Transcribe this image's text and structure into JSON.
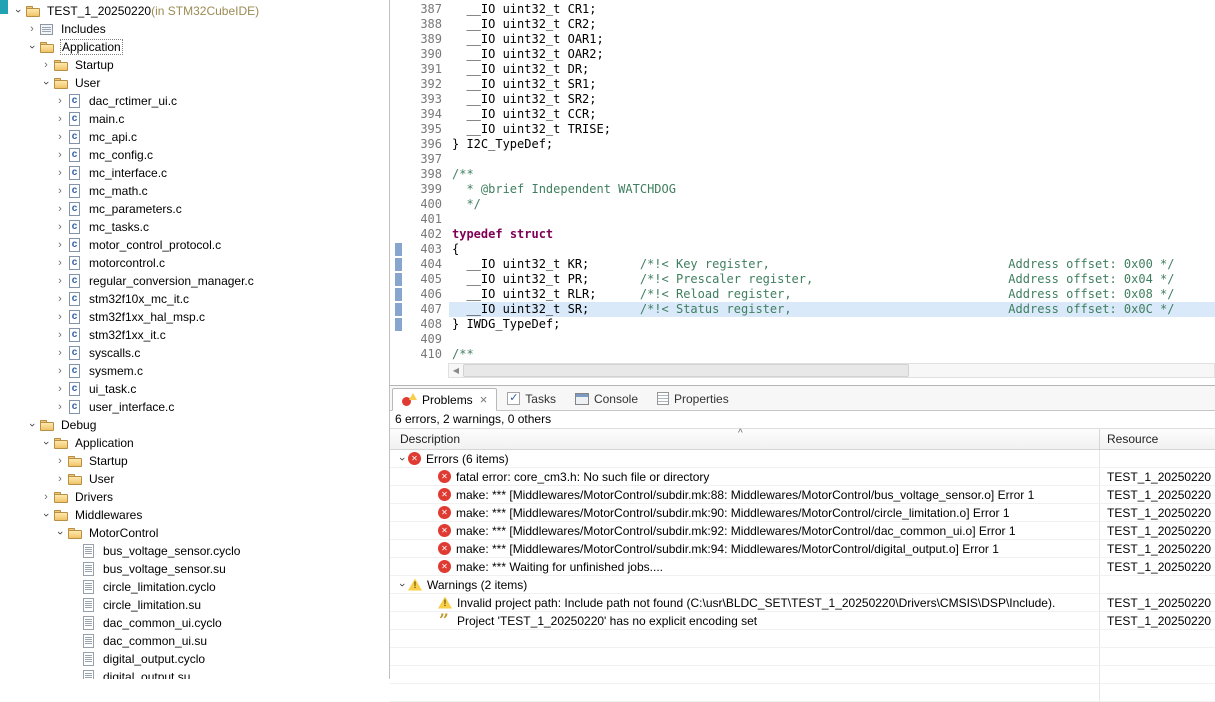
{
  "colors": {
    "keyword": "#7f0055",
    "comment": "#3f7f5f",
    "line_highlight": "#d9e9fa",
    "change_marker": "#87a5cd",
    "error_red": "#df3b32",
    "warning_yellow": "#f9ce4a"
  },
  "explorer": {
    "items": [
      {
        "label": "TEST_1_20250220",
        "suffix": " (in STM32CubeIDE)",
        "level": 0,
        "arrow": "expanded",
        "icon": "project"
      },
      {
        "label": "Includes",
        "level": 1,
        "arrow": "collapsed",
        "icon": "includes"
      },
      {
        "label": "Application",
        "level": 1,
        "arrow": "expanded",
        "icon": "folder",
        "focused": true
      },
      {
        "label": "Startup",
        "level": 2,
        "arrow": "collapsed",
        "icon": "folder"
      },
      {
        "label": "User",
        "level": 2,
        "arrow": "expanded",
        "icon": "folder"
      },
      {
        "label": "dac_rctimer_ui.c",
        "level": 3,
        "arrow": "collapsed",
        "icon": "cfile"
      },
      {
        "label": "main.c",
        "level": 3,
        "arrow": "collapsed",
        "icon": "cfile"
      },
      {
        "label": "mc_api.c",
        "level": 3,
        "arrow": "collapsed",
        "icon": "cfile"
      },
      {
        "label": "mc_config.c",
        "level": 3,
        "arrow": "collapsed",
        "icon": "cfile"
      },
      {
        "label": "mc_interface.c",
        "level": 3,
        "arrow": "collapsed",
        "icon": "cfile"
      },
      {
        "label": "mc_math.c",
        "level": 3,
        "arrow": "collapsed",
        "icon": "cfile"
      },
      {
        "label": "mc_parameters.c",
        "level": 3,
        "arrow": "collapsed",
        "icon": "cfile"
      },
      {
        "label": "mc_tasks.c",
        "level": 3,
        "arrow": "collapsed",
        "icon": "cfile"
      },
      {
        "label": "motor_control_protocol.c",
        "level": 3,
        "arrow": "collapsed",
        "icon": "cfile"
      },
      {
        "label": "motorcontrol.c",
        "level": 3,
        "arrow": "collapsed",
        "icon": "cfile"
      },
      {
        "label": "regular_conversion_manager.c",
        "level": 3,
        "arrow": "collapsed",
        "icon": "cfile"
      },
      {
        "label": "stm32f10x_mc_it.c",
        "level": 3,
        "arrow": "collapsed",
        "icon": "cfile"
      },
      {
        "label": "stm32f1xx_hal_msp.c",
        "level": 3,
        "arrow": "collapsed",
        "icon": "cfile"
      },
      {
        "label": "stm32f1xx_it.c",
        "level": 3,
        "arrow": "collapsed",
        "icon": "cfile"
      },
      {
        "label": "syscalls.c",
        "level": 3,
        "arrow": "collapsed",
        "icon": "cfile"
      },
      {
        "label": "sysmem.c",
        "level": 3,
        "arrow": "collapsed",
        "icon": "cfile"
      },
      {
        "label": "ui_task.c",
        "level": 3,
        "arrow": "collapsed",
        "icon": "cfile"
      },
      {
        "label": "user_interface.c",
        "level": 3,
        "arrow": "collapsed",
        "icon": "cfile"
      },
      {
        "label": "Debug",
        "level": 1,
        "arrow": "expanded",
        "icon": "folder"
      },
      {
        "label": "Application",
        "level": 2,
        "arrow": "expanded",
        "icon": "folder"
      },
      {
        "label": "Startup",
        "level": 3,
        "arrow": "collapsed",
        "icon": "folder"
      },
      {
        "label": "User",
        "level": 3,
        "arrow": "collapsed",
        "icon": "folder"
      },
      {
        "label": "Drivers",
        "level": 2,
        "arrow": "collapsed",
        "icon": "folder"
      },
      {
        "label": "Middlewares",
        "level": 2,
        "arrow": "expanded",
        "icon": "folder"
      },
      {
        "label": "MotorControl",
        "level": 3,
        "arrow": "expanded",
        "icon": "folder"
      },
      {
        "label": "bus_voltage_sensor.cyclo",
        "level": 4,
        "arrow": "none",
        "icon": "doc"
      },
      {
        "label": "bus_voltage_sensor.su",
        "level": 4,
        "arrow": "none",
        "icon": "doc"
      },
      {
        "label": "circle_limitation.cyclo",
        "level": 4,
        "arrow": "none",
        "icon": "doc"
      },
      {
        "label": "circle_limitation.su",
        "level": 4,
        "arrow": "none",
        "icon": "doc"
      },
      {
        "label": "dac_common_ui.cyclo",
        "level": 4,
        "arrow": "none",
        "icon": "doc"
      },
      {
        "label": "dac_common_ui.su",
        "level": 4,
        "arrow": "none",
        "icon": "doc"
      },
      {
        "label": "digital_output.cyclo",
        "level": 4,
        "arrow": "none",
        "icon": "doc"
      },
      {
        "label": "digital_output.su",
        "level": 4,
        "arrow": "none",
        "icon": "doc"
      }
    ]
  },
  "editor": {
    "lines": [
      {
        "n": 387,
        "seg": [
          [
            "plain",
            "  __IO uint32_t CR1;"
          ]
        ]
      },
      {
        "n": 388,
        "seg": [
          [
            "plain",
            "  __IO uint32_t CR2;"
          ]
        ]
      },
      {
        "n": 389,
        "seg": [
          [
            "plain",
            "  __IO uint32_t OAR1;"
          ]
        ]
      },
      {
        "n": 390,
        "seg": [
          [
            "plain",
            "  __IO uint32_t OAR2;"
          ]
        ]
      },
      {
        "n": 391,
        "seg": [
          [
            "plain",
            "  __IO uint32_t DR;"
          ]
        ]
      },
      {
        "n": 392,
        "seg": [
          [
            "plain",
            "  __IO uint32_t SR1;"
          ]
        ]
      },
      {
        "n": 393,
        "seg": [
          [
            "plain",
            "  __IO uint32_t SR2;"
          ]
        ]
      },
      {
        "n": 394,
        "seg": [
          [
            "plain",
            "  __IO uint32_t CCR;"
          ]
        ]
      },
      {
        "n": 395,
        "seg": [
          [
            "plain",
            "  __IO uint32_t TRISE;"
          ]
        ]
      },
      {
        "n": 396,
        "seg": [
          [
            "plain",
            "} I2C_TypeDef;"
          ]
        ]
      },
      {
        "n": 397,
        "seg": []
      },
      {
        "n": 398,
        "seg": [
          [
            "comment",
            "/**"
          ]
        ]
      },
      {
        "n": 399,
        "seg": [
          [
            "comment",
            "  * @brief Independent WATCHDOG"
          ]
        ]
      },
      {
        "n": 400,
        "seg": [
          [
            "comment",
            "  */"
          ]
        ]
      },
      {
        "n": 401,
        "seg": []
      },
      {
        "n": 402,
        "seg": [
          [
            "kw",
            "typedef"
          ],
          [
            "plain",
            " "
          ],
          [
            "kw",
            "struct"
          ]
        ]
      },
      {
        "n": 403,
        "marker": true,
        "seg": [
          [
            "plain",
            "{"
          ]
        ]
      },
      {
        "n": 404,
        "marker": true,
        "seg": [
          [
            "plain",
            "  __IO uint32_t KR;       "
          ],
          [
            "comment",
            "/*!< Key register,                                 Address offset: 0x00 */"
          ]
        ]
      },
      {
        "n": 405,
        "marker": true,
        "seg": [
          [
            "plain",
            "  __IO uint32_t PR;       "
          ],
          [
            "comment",
            "/*!< Prescaler register,                           Address offset: 0x04 */"
          ]
        ]
      },
      {
        "n": 406,
        "marker": true,
        "seg": [
          [
            "plain",
            "  __IO uint32_t RLR;      "
          ],
          [
            "comment",
            "/*!< Reload register,                              Address offset: 0x08 */"
          ]
        ]
      },
      {
        "n": 407,
        "marker": true,
        "hl": true,
        "seg": [
          [
            "plain",
            "  __IO uint32_t SR;       "
          ],
          [
            "comment",
            "/*!< Status register,                              Address offset: 0x0C */"
          ]
        ]
      },
      {
        "n": 408,
        "marker": true,
        "seg": [
          [
            "plain",
            "} IWDG_TypeDef;"
          ]
        ]
      },
      {
        "n": 409,
        "seg": []
      },
      {
        "n": 410,
        "seg": [
          [
            "comment",
            "/**"
          ]
        ]
      }
    ]
  },
  "problems": {
    "tabs": [
      {
        "label": "Problems",
        "icon": "problems",
        "selected": true,
        "closable": true
      },
      {
        "label": "Tasks",
        "icon": "tasks"
      },
      {
        "label": "Console",
        "icon": "console"
      },
      {
        "label": "Properties",
        "icon": "properties"
      }
    ],
    "summary": "6 errors, 2 warnings, 0 others",
    "columns": [
      "Description",
      "Resource"
    ],
    "rows": [
      {
        "type": "group",
        "icon": "error",
        "text": "Errors (6 items)"
      },
      {
        "type": "item",
        "icon": "error",
        "text": "fatal error: core_cm3.h: No such file or directory",
        "resource": "TEST_1_20250220"
      },
      {
        "type": "item",
        "icon": "error",
        "text": "make: *** [Middlewares/MotorControl/subdir.mk:88: Middlewares/MotorControl/bus_voltage_sensor.o] Error 1",
        "resource": "TEST_1_20250220"
      },
      {
        "type": "item",
        "icon": "error",
        "text": "make: *** [Middlewares/MotorControl/subdir.mk:90: Middlewares/MotorControl/circle_limitation.o] Error 1",
        "resource": "TEST_1_20250220"
      },
      {
        "type": "item",
        "icon": "error",
        "text": "make: *** [Middlewares/MotorControl/subdir.mk:92: Middlewares/MotorControl/dac_common_ui.o] Error 1",
        "resource": "TEST_1_20250220"
      },
      {
        "type": "item",
        "icon": "error",
        "text": "make: *** [Middlewares/MotorControl/subdir.mk:94: Middlewares/MotorControl/digital_output.o] Error 1",
        "resource": "TEST_1_20250220"
      },
      {
        "type": "item",
        "icon": "error",
        "text": "make: *** Waiting for unfinished jobs....",
        "resource": "TEST_1_20250220"
      },
      {
        "type": "group",
        "icon": "warning",
        "text": "Warnings (2 items)"
      },
      {
        "type": "item",
        "icon": "warning",
        "text": "Invalid project path: Include path not found (C:\\usr\\BLDC_SET\\TEST_1_20250220\\Drivers\\CMSIS\\DSP\\Include).",
        "resource": "TEST_1_20250220"
      },
      {
        "type": "item",
        "icon": "encoding-warning",
        "text": "Project 'TEST_1_20250220' has no explicit encoding set",
        "resource": "TEST_1_20250220"
      }
    ]
  }
}
